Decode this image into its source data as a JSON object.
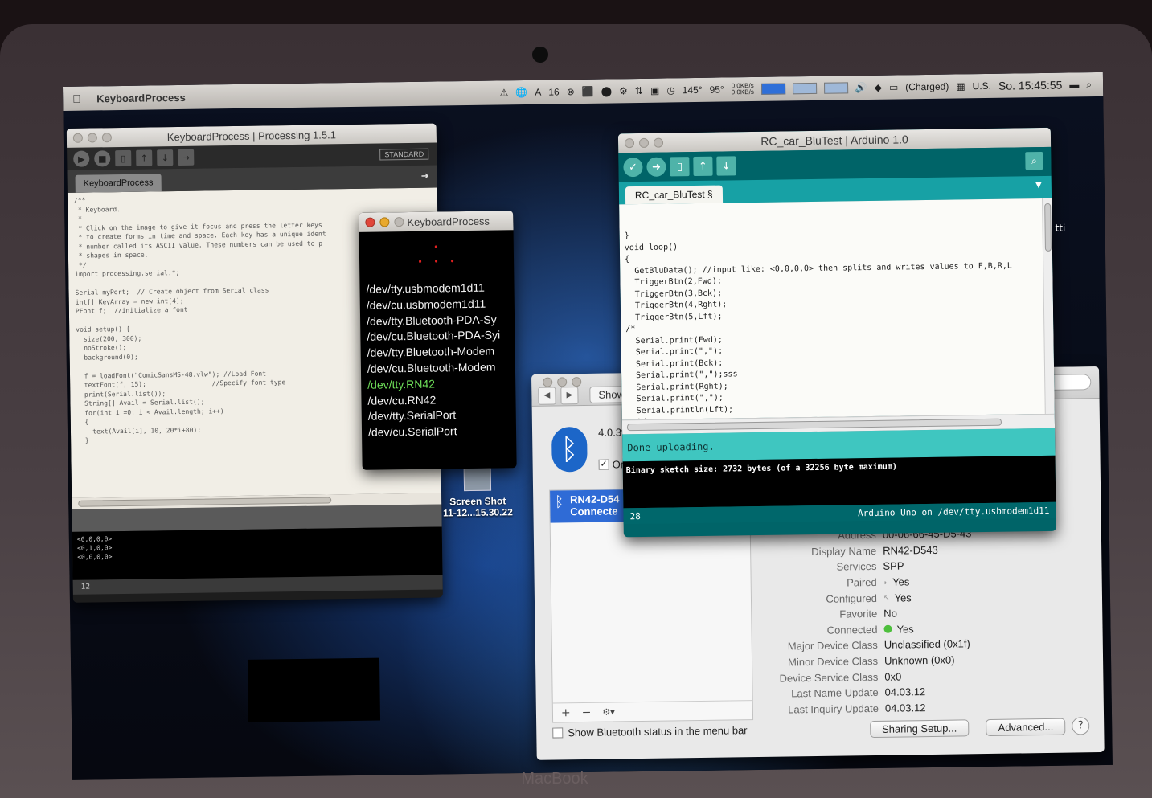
{
  "menubar": {
    "app_name": "KeyboardProcess",
    "status_items": [
      "⚠",
      "🌐",
      "A",
      "16",
      "⊗",
      "⬛",
      "⬤",
      "⚙",
      "⇅",
      "▣",
      "◷",
      "145°",
      "95°"
    ],
    "network_up": "0.0KB/s",
    "network_down": "0.0KB/s",
    "battery": "(Charged)",
    "input_source": "U.S.",
    "clock": "So. 15:45:55"
  },
  "processing": {
    "title": "KeyboardProcess | Processing 1.5.1",
    "mode": "STANDARD",
    "tab": "KeyboardProcess",
    "code": "/**\n * Keyboard.\n *\n * Click on the image to give it focus and press the letter keys\n * to create forms in time and space. Each key has a unique ident\n * number called its ASCII value. These numbers can be used to p\n * shapes in space.\n */\nimport processing.serial.*;\n\nSerial myPort;  // Create object from Serial class\nint[] KeyArray = new int[4];\nPFont f;  //initialize a font\n\nvoid setup() {\n  size(200, 300);\n  noStroke();\n  background(0);\n\n  f = loadFont(\"ComicSansMS-48.vlw\"); //Load Font\n  textFont(f, 15);                 //Specify font type\n  print(Serial.list());\n  String[] Avail = Serial.list();\n  for(int i =0; i < Avail.length; i++)\n  {\n    text(Avail[i], 10, 20*i+80);\n  }",
    "console_lines": [
      "<0,0,0,0>",
      "<0,1,0,0>",
      "<0,0,0,0>"
    ],
    "status_line": "12"
  },
  "sketch": {
    "title": "KeyboardProcess",
    "ports": [
      "/dev/tty.usbmodem1d11",
      "/dev/cu.usbmodem1d11",
      "/dev/tty.Bluetooth-PDA-Sy",
      "/dev/cu.Bluetooth-PDA-Syi",
      "/dev/tty.Bluetooth-Modem",
      "/dev/cu.Bluetooth-Modem",
      "/dev/tty.RN42",
      "/dev/cu.RN42",
      "/dev/tty.SerialPort",
      "/dev/cu.SerialPort"
    ],
    "highlighted_port": "/dev/tty.RN42"
  },
  "arduino": {
    "title": "RC_car_BluTest | Arduino 1.0",
    "tab": "RC_car_BluTest §",
    "code_lines": [
      "}",
      "void loop()",
      "{",
      "  GetBluData(); //input like: <0,0,0,0> then splits and writes values to F,B,R,L",
      "  TriggerBtn(2,Fwd);",
      "  TriggerBtn(3,Bck);",
      "  TriggerBtn(4,Rght);",
      "  TriggerBtn(5,Lft);",
      "/*",
      "  Serial.print(Fwd);",
      "  Serial.print(\",\");",
      "  Serial.print(Bck);",
      "  Serial.print(\",\");sss",
      "  Serial.print(Rght);",
      "  Serial.print(\",\");",
      "  Serial.println(Lft);",
      "  */",
      "}"
    ],
    "status": "Done uploading.",
    "console": "Binary sketch size: 2732 bytes (of a 32256 byte maximum)",
    "line_number": "28",
    "board": "Arduino Uno on /dev/tty.usbmodem1d11",
    "overflow_text": "tti"
  },
  "bluetooth": {
    "show_label": "Show",
    "version": "4.0.3f",
    "on_label": "On",
    "device_name": "RN42-D54",
    "device_status": "Connecte",
    "properties": [
      {
        "key": "Address",
        "value": "00-06-66-45-D5-43"
      },
      {
        "key": "Display Name",
        "value": "RN42-D543"
      },
      {
        "key": "Services",
        "value": "SPP"
      },
      {
        "key": "Paired",
        "value": "Yes"
      },
      {
        "key": "Configured",
        "value": "Yes"
      },
      {
        "key": "Favorite",
        "value": "No"
      },
      {
        "key": "Connected",
        "value": "Yes"
      },
      {
        "key": "Major Device Class",
        "value": "Unclassified (0x1f)"
      },
      {
        "key": "Minor Device Class",
        "value": "Unknown (0x0)"
      },
      {
        "key": "Device Service Class",
        "value": "0x0"
      },
      {
        "key": "Last Name Update",
        "value": "04.03.12"
      },
      {
        "key": "Last Inquiry Update",
        "value": "04.03.12"
      }
    ],
    "menubar_option": "Show Bluetooth status in the menu bar",
    "sharing_button": "Sharing Setup...",
    "advanced_button": "Advanced...",
    "help_button": "?",
    "add_button": "+",
    "remove_button": "−",
    "gear_button": "⚙▾"
  },
  "desktop": {
    "file_name": "Screen Shot",
    "file_date": "11-12...15.30.22"
  },
  "laptop": {
    "brand": "MacBook"
  }
}
